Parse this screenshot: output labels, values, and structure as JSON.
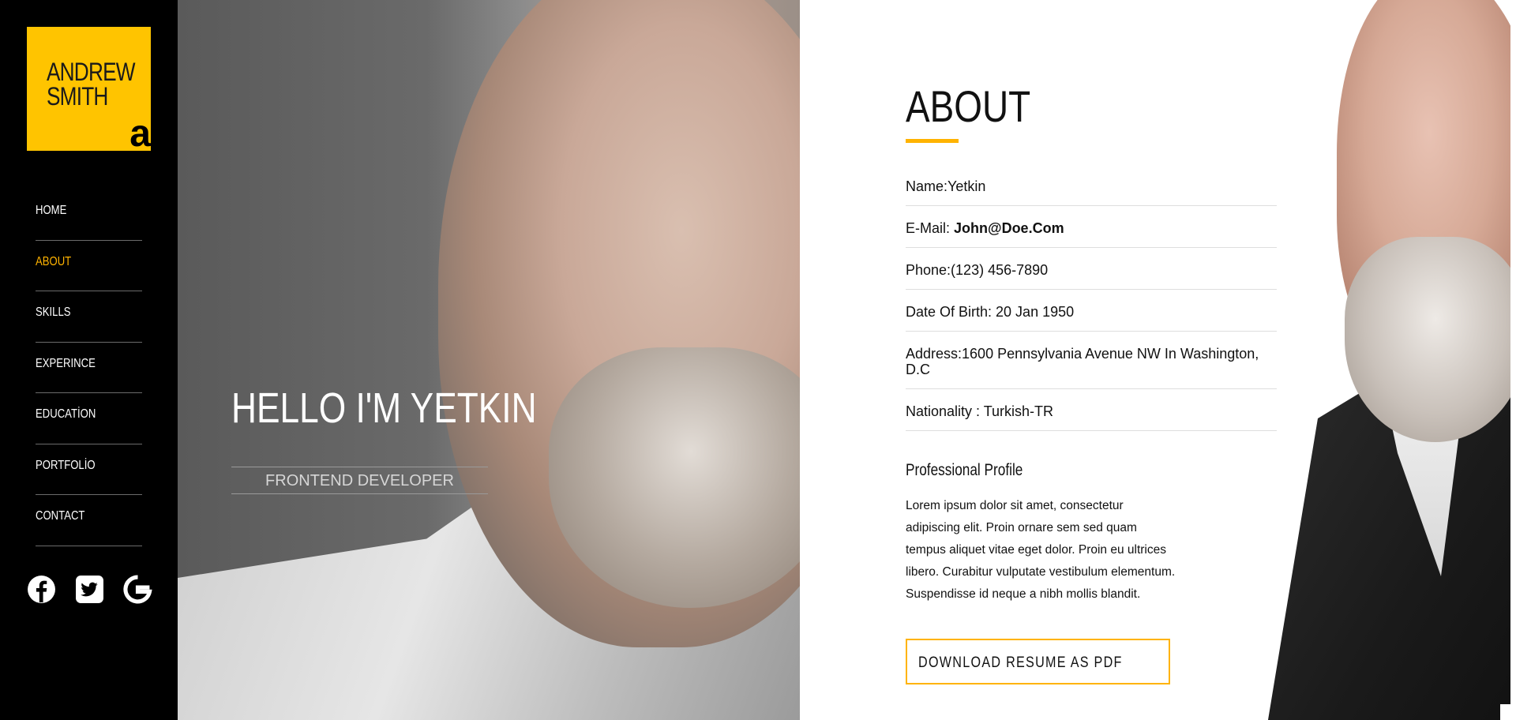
{
  "logo": {
    "line1": "ANDREW",
    "line2": "SMITH",
    "mark": "a"
  },
  "nav": [
    {
      "label": "HOME",
      "active": false
    },
    {
      "label": "ABOUT",
      "active": true
    },
    {
      "label": "SKILLS",
      "active": false
    },
    {
      "label": "EXPERINCE",
      "active": false
    },
    {
      "label": "EDUCATİON",
      "active": false
    },
    {
      "label": "PORTFOLİO",
      "active": false
    },
    {
      "label": "CONTACT",
      "active": false
    }
  ],
  "social": [
    {
      "icon": "facebook-icon"
    },
    {
      "icon": "twitter-icon"
    },
    {
      "icon": "google-icon"
    }
  ],
  "hero": {
    "greeting": "HELLO I'M YETKIN",
    "role": "FRONTEND DEVELOPER"
  },
  "about": {
    "title": "ABOUT",
    "name": "Name:Yetkin",
    "email_label": "E-Mail: ",
    "email_value": "John@Doe.Com",
    "phone": "Phone:(123) 456-7890",
    "dob": "Date Of Birth: 20 Jan 1950",
    "address": "Address:1600 Pennsylvania Avenue NW In Washington, D.C",
    "nationality": "Nationality : Turkish-TR",
    "profile_title": "Professional Profile",
    "profile_text": "Lorem ipsum dolor sit amet, consectetur adipiscing elit. Proin ornare sem sed quam tempus aliquet vitae eget dolor. Proin eu ultrices libero. Curabitur vulputate vestibulum elementum. Suspendisse id neque a nibh mollis blandit.",
    "download_button": "DOWNLOAD RESUME AS PDF"
  },
  "colors": {
    "accent": "#ffb300",
    "logo_bg": "#ffc400",
    "sidebar_bg": "#000000"
  }
}
